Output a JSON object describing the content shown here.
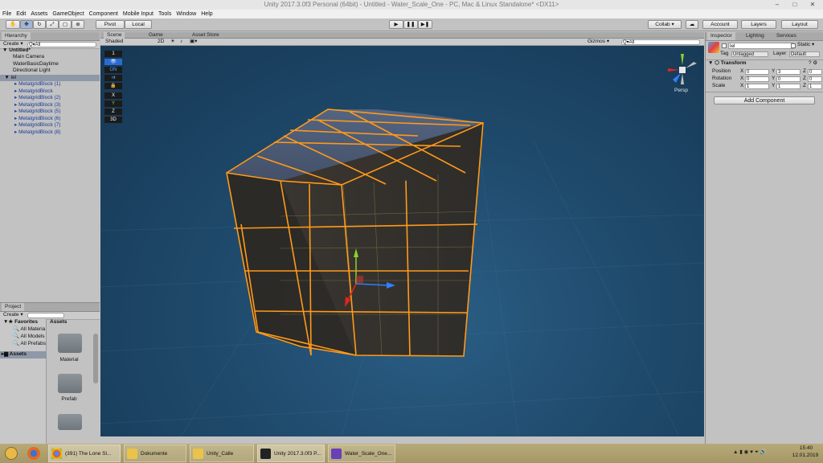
{
  "window": {
    "title": "Unity 2017.3.0f3 Personal (64bit) - Untitled - Water_Scale_One - PC, Mac & Linux Standalone* <DX11>"
  },
  "menu": [
    "File",
    "Edit",
    "Assets",
    "GameObject",
    "Component",
    "Mobile Input",
    "Tools",
    "Window",
    "Help"
  ],
  "toolbar": {
    "pivot": "Pivot",
    "local": "Local",
    "collab": "Collab ▾",
    "account": "Account",
    "layers": "Layers",
    "layout": "Layout"
  },
  "hierarchy": {
    "tab": "Hierarchy",
    "create": "Create ▾",
    "search_placeholder": "Q▾All",
    "scene_name": "Untitled*",
    "items": [
      "Main Camera",
      "WaterBasicDaytime",
      "Directional Light"
    ],
    "selected": "lel",
    "children": [
      "MetalgridBlock (1)",
      "MetalgridBlock",
      "MetalgridBlock (2)",
      "MetalgridBlock (3)",
      "MetalgridBlock (5)",
      "MetalgridBlock (6)",
      "MetalgridBlock (7)",
      "MetalgridBlock (8)"
    ]
  },
  "project": {
    "tab": "Project",
    "create": "Create ▾",
    "favorites": "Favorites",
    "fav_items": [
      "All Materia",
      "All Models",
      "All Prefabs"
    ],
    "assets_root": "Assets",
    "assets_header": "Assets",
    "folders": [
      "Material",
      "Prefab",
      ""
    ]
  },
  "scene": {
    "tabs": [
      "Scene",
      "Game",
      "Asset Store"
    ],
    "shaded": "Shaded",
    "mode2d": "2D",
    "gizmos": "Gizmos ▾",
    "search": "Q▾All",
    "persp": "Persp",
    "left_tools": [
      "1",
      "",
      "ON",
      "",
      "",
      "X",
      "Y",
      "Z",
      "3D"
    ]
  },
  "inspector": {
    "tabs": [
      "Inspector",
      "Lighting",
      "Services"
    ],
    "object_name": "lel",
    "static_label": "Static ▾",
    "tag_label": "Tag",
    "tag_value": "Untagged",
    "layer_label": "Layer",
    "layer_value": "Default",
    "transform_label": "Transform",
    "rows": [
      {
        "label": "Position",
        "x": "0",
        "y": "3",
        "z": "0"
      },
      {
        "label": "Rotation",
        "x": "0",
        "y": "0",
        "z": "0"
      },
      {
        "label": "Scale",
        "x": "1",
        "y": "1",
        "z": "1"
      }
    ],
    "add_component": "Add Component"
  },
  "taskbar": {
    "items": [
      "(391) The Lone Sl...",
      "Dokumente",
      "Unity_Calle",
      "Unity 2017.3.0f3 P...",
      "Water_Scale_One..."
    ],
    "time": "15:40",
    "date": "12.01.2019"
  }
}
